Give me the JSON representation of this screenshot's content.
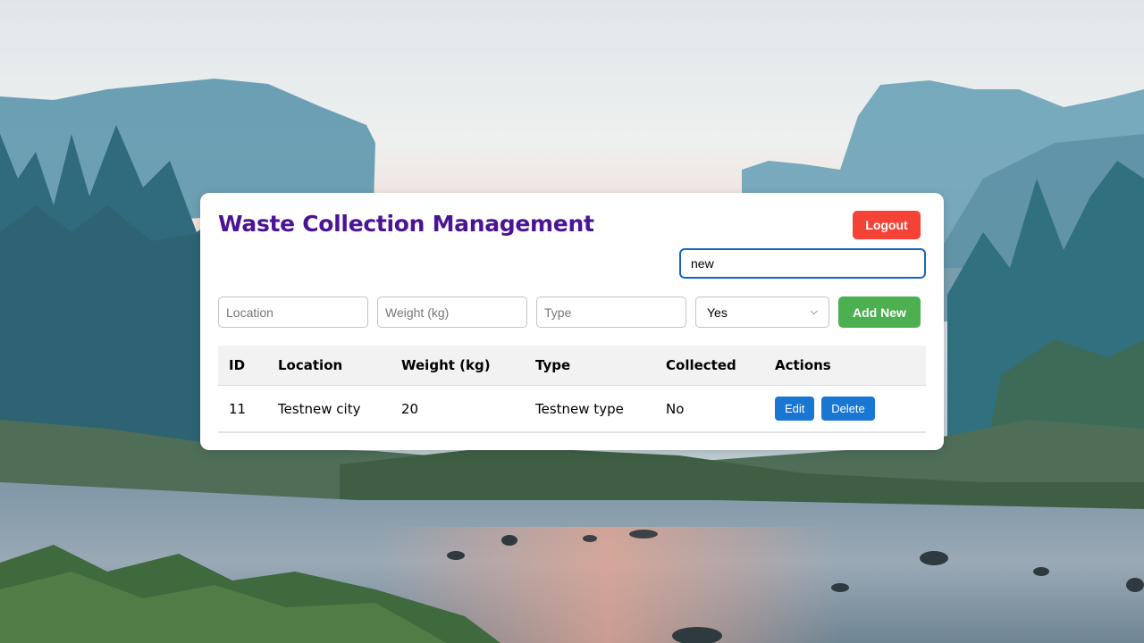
{
  "app": {
    "title": "Waste Collection Management",
    "logout_label": "Logout"
  },
  "search": {
    "value": "new"
  },
  "form": {
    "location_placeholder": "Location",
    "weight_placeholder": "Weight (kg)",
    "type_placeholder": "Type",
    "collected_selected": "Yes",
    "add_label": "Add New"
  },
  "table": {
    "headers": [
      "ID",
      "Location",
      "Weight (kg)",
      "Type",
      "Collected",
      "Actions"
    ],
    "rows": [
      {
        "id": "11",
        "location": "Testnew city",
        "weight": "20",
        "type": "Testnew type",
        "collected": "No",
        "edit_label": "Edit",
        "delete_label": "Delete"
      }
    ]
  },
  "colors": {
    "title": "#4b1494",
    "logout": "#f44336",
    "add": "#4caf50",
    "action": "#1976d2",
    "search_border": "#1565c0"
  },
  "icons": {
    "select_arrow": "chevron-down-icon"
  }
}
